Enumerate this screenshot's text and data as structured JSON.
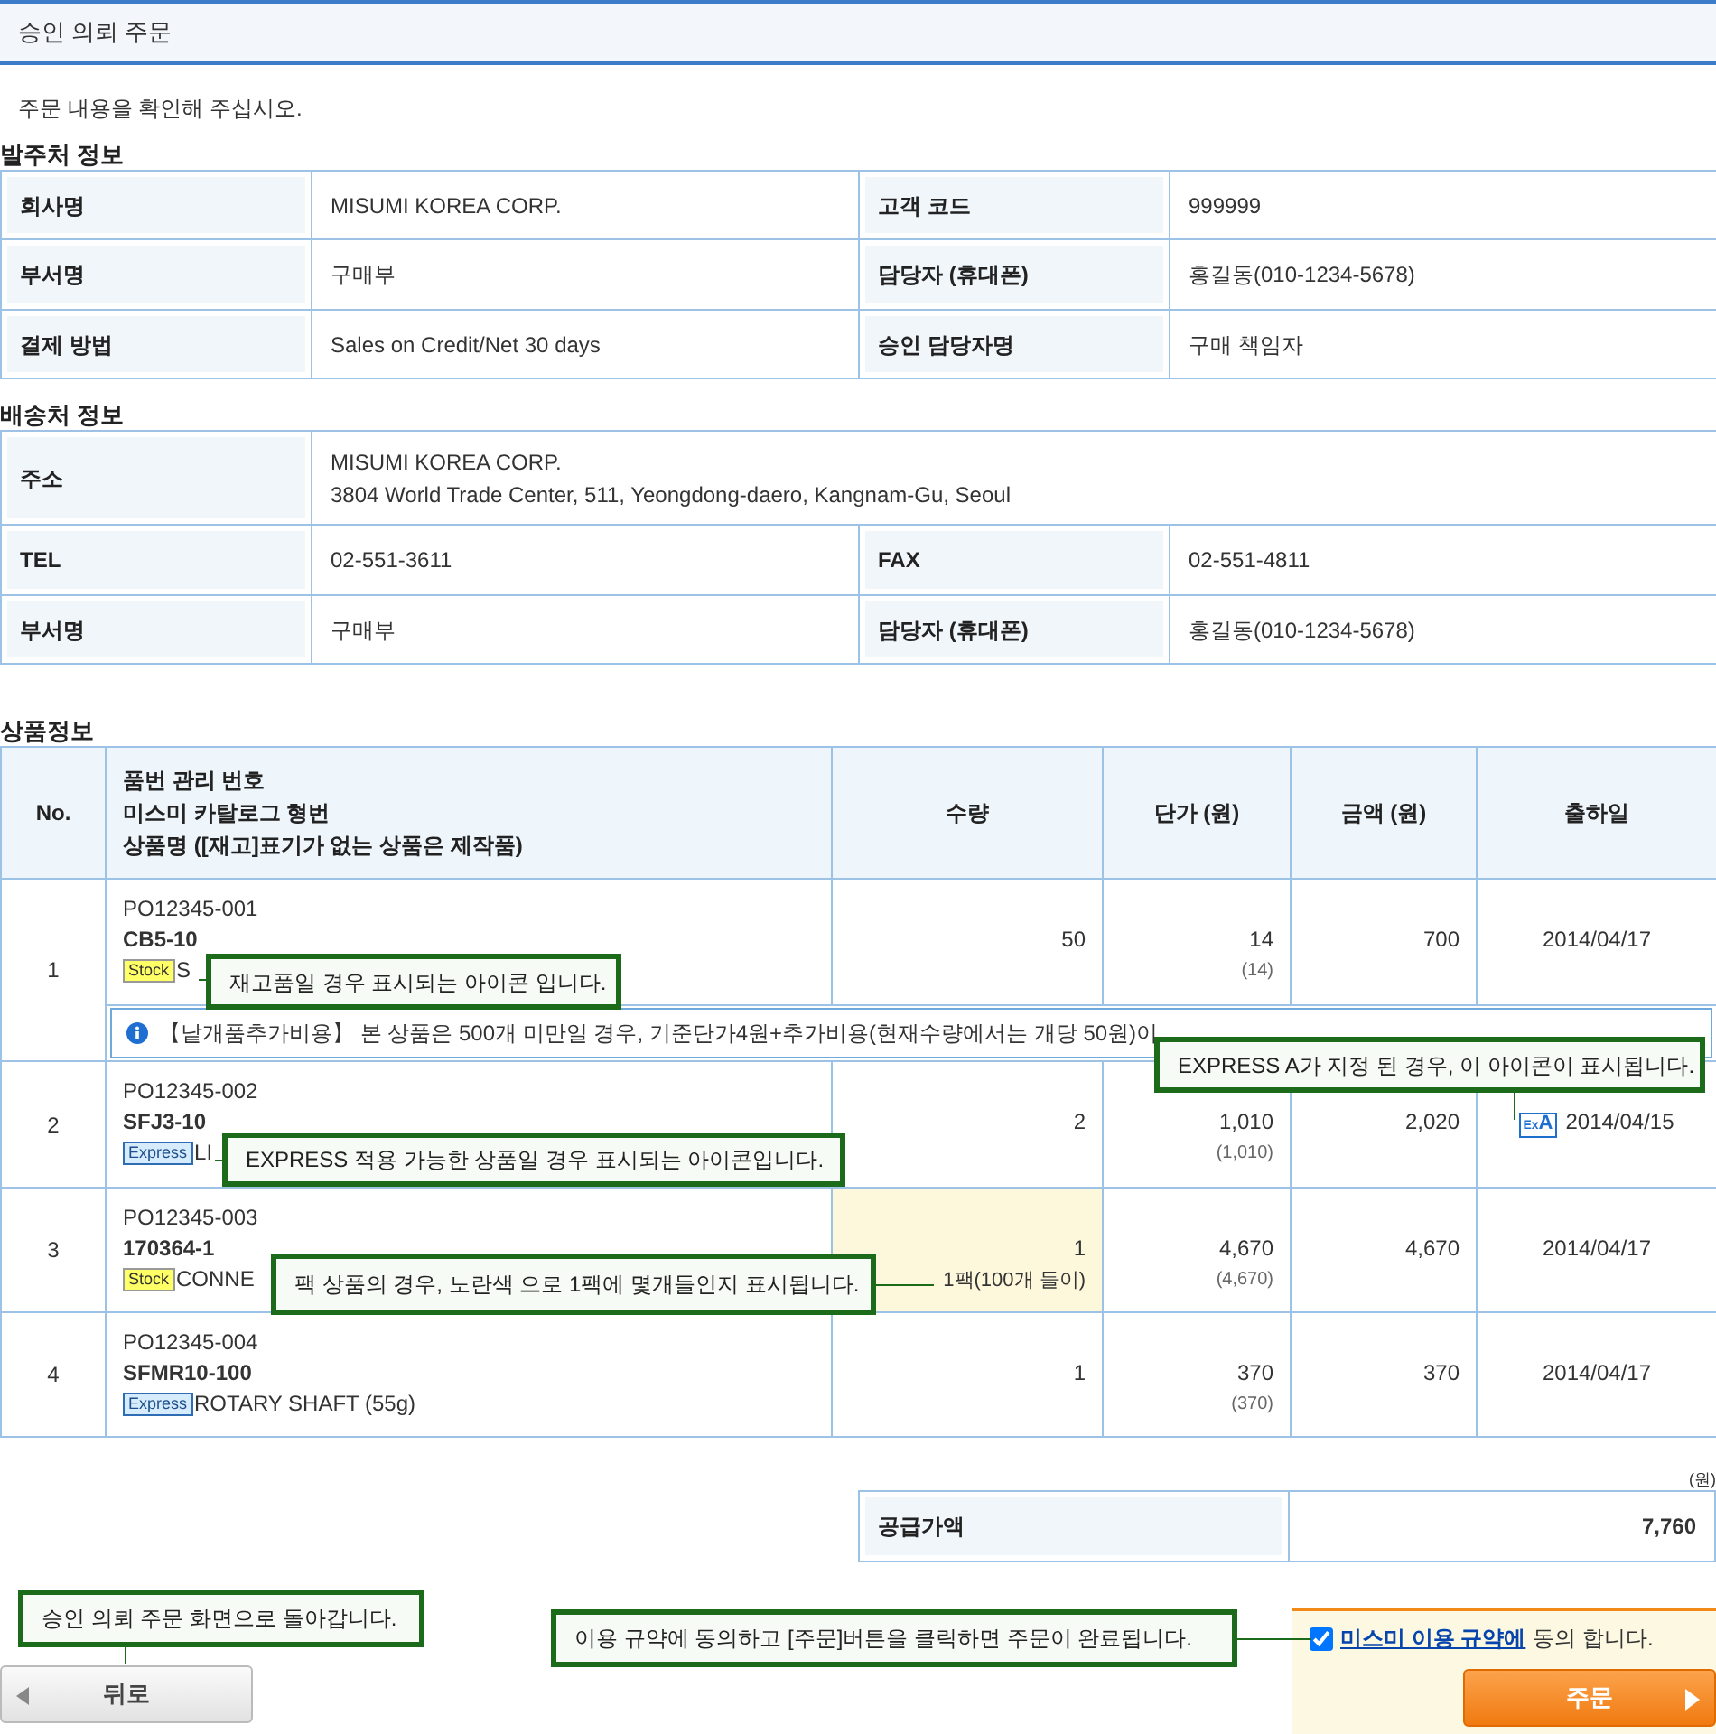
{
  "page_title": "승인 의뢰 주문",
  "instruction": "주문 내용을 확인해 주십시오.",
  "orderer": {
    "title": "발주처 정보",
    "rows": [
      [
        {
          "label": "회사명",
          "value": "MISUMI KOREA CORP."
        },
        {
          "label": "고객 코드",
          "value": "999999"
        }
      ],
      [
        {
          "label": "부서명",
          "value": "구매부"
        },
        {
          "label": "담당자 (휴대폰)",
          "value": "홍길동(010-1234-5678)"
        }
      ],
      [
        {
          "label": "결제 방법",
          "value": "Sales on Credit/Net 30 days"
        },
        {
          "label": "승인 담당자명",
          "value": "구매 책임자"
        }
      ]
    ]
  },
  "shipping": {
    "title": "배송처 정보",
    "address": {
      "label": "주소",
      "lines": [
        "MISUMI KOREA CORP.",
        "3804 World Trade Center, 511, Yeongdong-daero, Kangnam-Gu, Seoul"
      ]
    },
    "rows": [
      [
        {
          "label": "TEL",
          "value": "02-551-3611"
        },
        {
          "label": "FAX",
          "value": "02-551-4811"
        }
      ],
      [
        {
          "label": "부서명",
          "value": "구매부"
        },
        {
          "label": "담당자 (휴대폰)",
          "value": "홍길동(010-1234-5678)"
        }
      ]
    ]
  },
  "products": {
    "title": "상품정보",
    "columns": [
      {
        "lines": [
          "No."
        ]
      },
      {
        "lines": [
          "품번 관리 번호",
          "미스미 카탈로그 형번",
          "상품명 ([재고]표기가 없는 상품은 제작품)"
        ]
      },
      {
        "lines": [
          "수량"
        ]
      },
      {
        "lines": [
          "단가 (원)"
        ]
      },
      {
        "lines": [
          "금액 (원)"
        ]
      },
      {
        "lines": [
          "출하일"
        ]
      }
    ],
    "rows": [
      {
        "no": "1",
        "order_no": "PO12345-001",
        "part_no": "CB5-10",
        "badge": {
          "kind": "stock",
          "label": "Stock"
        },
        "name": "S",
        "quantity": "50",
        "pack": false,
        "unit_price": "14",
        "unit_price_sub": "(14)",
        "amount": "700",
        "ship_date": "2014/04/17",
        "notice": "【낱개품추가비용】 본 상품은 500개 미만일 경우, 기준단가4원+추가비용(현재수량에서는 개당 50원)이"
      },
      {
        "no": "2",
        "order_no": "PO12345-002",
        "part_no": "SFJ3-10",
        "badge": {
          "kind": "express",
          "label": "Express"
        },
        "name": "LI",
        "quantity": "2",
        "pack": false,
        "unit_price": "1,010",
        "unit_price_sub": "(1,010)",
        "amount": "2,020",
        "express_a": {
          "small": "Ex",
          "big": "A"
        },
        "ship_date": "2014/04/15"
      },
      {
        "no": "3",
        "order_no": "PO12345-003",
        "part_no": "170364-1",
        "badge": {
          "kind": "stock",
          "label": "Stock"
        },
        "name": "CONNE",
        "quantity": "1",
        "pack": true,
        "pack_note": "1팩(100개 들이)",
        "unit_price": "4,670",
        "unit_price_sub": "(4,670)",
        "amount": "4,670",
        "ship_date": "2014/04/17"
      },
      {
        "no": "4",
        "order_no": "PO12345-004",
        "part_no": "SFMR10-100",
        "badge": {
          "kind": "express",
          "label": "Express"
        },
        "name": "ROTARY SHAFT (55g)",
        "quantity": "1",
        "pack": false,
        "unit_price": "370",
        "unit_price_sub": "(370)",
        "amount": "370",
        "ship_date": "2014/04/17"
      }
    ]
  },
  "currency_note": "(원)",
  "total": {
    "label": "공급가액",
    "value": "7,760"
  },
  "back_button": "뒤로",
  "agreement": {
    "checked": true,
    "link": "미스미 이용 규약에",
    "text": "동의 합니다."
  },
  "order_button": "주문",
  "annotations": [
    {
      "text": "재고품일 경우 표시되는 아이콘 입니다."
    },
    {
      "text": "EXPRESS A가 지정 된 경우, 이 아이콘이 표시됩니다."
    },
    {
      "text": "EXPRESS 적용 가능한 상품일 경우 표시되는 아이콘입니다."
    },
    {
      "text": "팩 상품의 경우, 노란색 으로 1팩에 몇개들인지 표시됩니다."
    },
    {
      "text": "승인 의뢰 주문 화면으로 돌아갑니다."
    },
    {
      "text": "이용 규약에 동의하고 [주문]버튼을 클릭하면 주문이 완료됩니다."
    }
  ]
}
